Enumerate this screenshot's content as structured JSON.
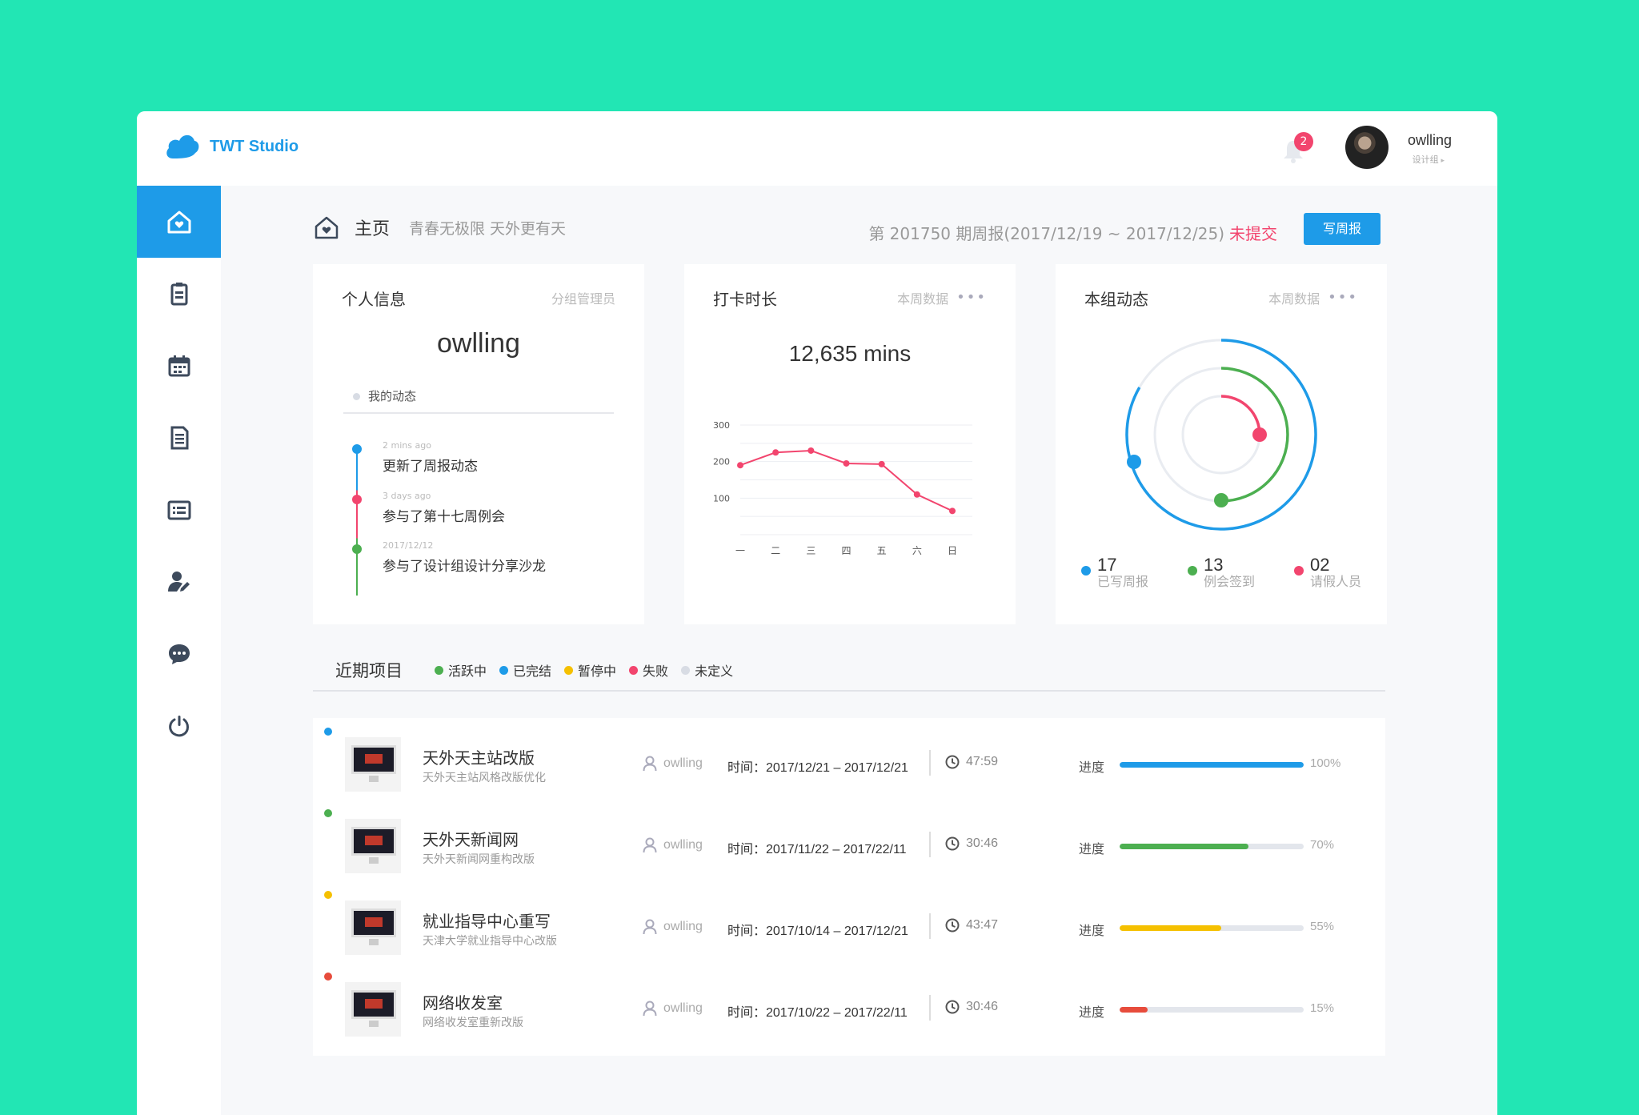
{
  "app": {
    "name": "TWT Studio",
    "brand_color": "#1e9be8"
  },
  "header": {
    "notification_count": "2",
    "user_name": "owlling",
    "user_role": "设计组"
  },
  "sidebar": {
    "items": [
      {
        "icon": "home-icon",
        "active": true
      },
      {
        "icon": "report-icon"
      },
      {
        "icon": "calendar-icon"
      },
      {
        "icon": "document-icon"
      },
      {
        "icon": "list-icon"
      },
      {
        "icon": "user-edit-icon"
      },
      {
        "icon": "chat-icon"
      },
      {
        "icon": "power-icon"
      }
    ]
  },
  "page": {
    "title": "主页",
    "subtitle": "青春无极限 天外更有天",
    "week_info": "第 201750 期周报(2017/12/19 ~ 2017/12/25)",
    "week_status": "未提交",
    "write_button": "写周报"
  },
  "personal": {
    "title": "个人信息",
    "meta": "分组管理员",
    "name": "owlling",
    "tab": "我的动态",
    "timeline": [
      {
        "time": "2 mins ago",
        "text": "更新了周报动态",
        "color": "#1e9be8"
      },
      {
        "time": "3 days ago",
        "text": "参与了第十七周例会",
        "color": "#f2456e"
      },
      {
        "time": "2017/12/12",
        "text": "参与了设计组设计分享沙龙",
        "color": "#4caf50"
      }
    ]
  },
  "checkin": {
    "title": "打卡时长",
    "meta": "本周数据",
    "total": "12,635 mins",
    "chart_data": {
      "type": "line",
      "categories": [
        "一",
        "二",
        "三",
        "四",
        "五",
        "六",
        "日"
      ],
      "yticks": [
        "300",
        "200",
        "100"
      ],
      "ylim": [
        0,
        300
      ],
      "series": [
        {
          "values": [
            190,
            225,
            230,
            195,
            193,
            110,
            65
          ],
          "color": "#f2456e"
        }
      ],
      "grid": true
    }
  },
  "group": {
    "title": "本组动态",
    "meta": "本周数据",
    "stats": [
      {
        "value": "17",
        "label": "已写周报",
        "color": "#1e9be8"
      },
      {
        "value": "13",
        "label": "例会签到",
        "color": "#4caf50"
      },
      {
        "value": "02",
        "label": "请假人员",
        "color": "#f2456e"
      }
    ]
  },
  "projects": {
    "title": "近期项目",
    "legend": [
      {
        "label": "活跃中",
        "color": "#4caf50"
      },
      {
        "label": "已完结",
        "color": "#1e9be8"
      },
      {
        "label": "暂停中",
        "color": "#f5c000"
      },
      {
        "label": "失败",
        "color": "#f2456e"
      },
      {
        "label": "未定义",
        "color": "#d8dce4"
      }
    ],
    "progress_label": "进度",
    "rows": [
      {
        "name": "天外天主站改版",
        "desc": "天外天主站风格改版优化",
        "owner": "owlling",
        "time": "时间：2017/12/21 – 2017/12/21",
        "duration": "47:59",
        "progress": 1.0,
        "progress_text": "100%",
        "color": "#1e9be8"
      },
      {
        "name": "天外天新闻网",
        "desc": "天外天新闻网重构改版",
        "owner": "owlling",
        "time": "时间：2017/11/22 – 2017/22/11",
        "duration": "30:46",
        "progress": 0.7,
        "progress_text": "70%",
        "color": "#4caf50"
      },
      {
        "name": "就业指导中心重写",
        "desc": "天津大学就业指导中心改版",
        "owner": "owlling",
        "time": "时间：2017/10/14 – 2017/12/21",
        "duration": "43:47",
        "progress": 0.55,
        "progress_text": "55%",
        "color": "#f5c000"
      },
      {
        "name": "网络收发室",
        "desc": "网络收发室重新改版",
        "owner": "owlling",
        "time": "时间：2017/10/22 – 2017/22/11",
        "duration": "30:46",
        "progress": 0.15,
        "progress_text": "15%",
        "color": "#e74c3c"
      }
    ]
  }
}
